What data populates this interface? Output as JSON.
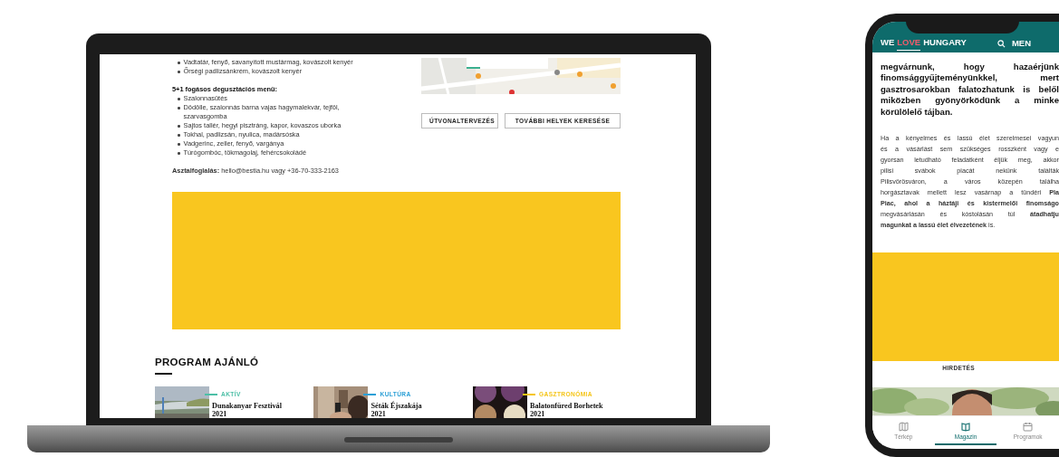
{
  "laptop": {
    "screen": {
      "dish_list": [
        "Vadtatár, fenyő, savanyított mustármag, kovászolt kenyér",
        "Őrségi padlizsánkrém, kovászolt kenyér"
      ],
      "menu_title": "5+1 fogásos degusztációs menü:",
      "menu_items": [
        "Szalonnasütés",
        "Dödölle, szalonnás barna vajas hagymalekvár, tejföl, szarvasgomba",
        "Sajtos tallér, hegyi pisztráng, kapor, kovaszos uborka",
        "Tokhal, padlizsán, nyulica, madársóska",
        "Vadgerinc, zeller, fenyő, vargánya",
        "Túrógombóc, tökmagolaj, fehércsokoládé"
      ],
      "booking": "**Asztalfoglalás:** hello@bestia.hu vagy +36-70-333-2163",
      "buttons": [
        "ÚTVONALTERVEZÉS",
        "TOVÁBBI HELYEK KERESÉSE"
      ],
      "section_title": "PROGRAM AJÁNLÓ",
      "programs": [
        {
          "category": "AKTÍV",
          "color": "#4cbfa6",
          "title": "Dunakanyar Fesztivál",
          "year": "2021"
        },
        {
          "category": "KULTÚRA",
          "color": "#2a9fd6",
          "title": "Séták Éjszakája",
          "year": "2021"
        },
        {
          "category": "GASZTRONÓMIA",
          "color": "#f5c518",
          "title": "Balatonfüred Borhetek",
          "year": "2021"
        }
      ]
    }
  },
  "phone": {
    "logo": [
      {
        "text": "WE",
        "highlight": false
      },
      {
        "text": "LOVE",
        "highlight": true
      },
      {
        "text": "HUNGARY",
        "highlight": false
      }
    ],
    "menu_label": "MEN",
    "intro_lines": [
      "megvárnunk, hogy hazaérjünk",
      "finomsággyűjteményünkkel, mert",
      "gasztrosarokban falatozhatunk is belől",
      "miközben gyönyörködünk a minke",
      "körülölelő tájban."
    ],
    "body_lines": [
      "Ha a kényelmes és lassú élet szerelmesei vagyun",
      "és a vásárlást sem szükséges rosszként vagy e",
      "gyorsan letudható feladatként éljük meg, akkor",
      "pilisi svábok piacát nekünk találták",
      "Pilisvörösváron, a város közepén találha",
      "horgásztavak mellett lesz vasárnap a tündéri **Pla**",
      "**Piac, ahol a háztáji és kistermelői finomságo**",
      "megvásárlásán és kóstolásán túl **átadhatju**",
      "**magunkat a lassú élet élvezetének** is."
    ],
    "ad_label": "HIRDETÉS",
    "nav": [
      {
        "kind": "map",
        "label": "Térkép",
        "selected": false
      },
      {
        "kind": "magazine",
        "label": "Magazin",
        "selected": true
      },
      {
        "kind": "calendar",
        "label": "Programok",
        "selected": false
      }
    ]
  }
}
